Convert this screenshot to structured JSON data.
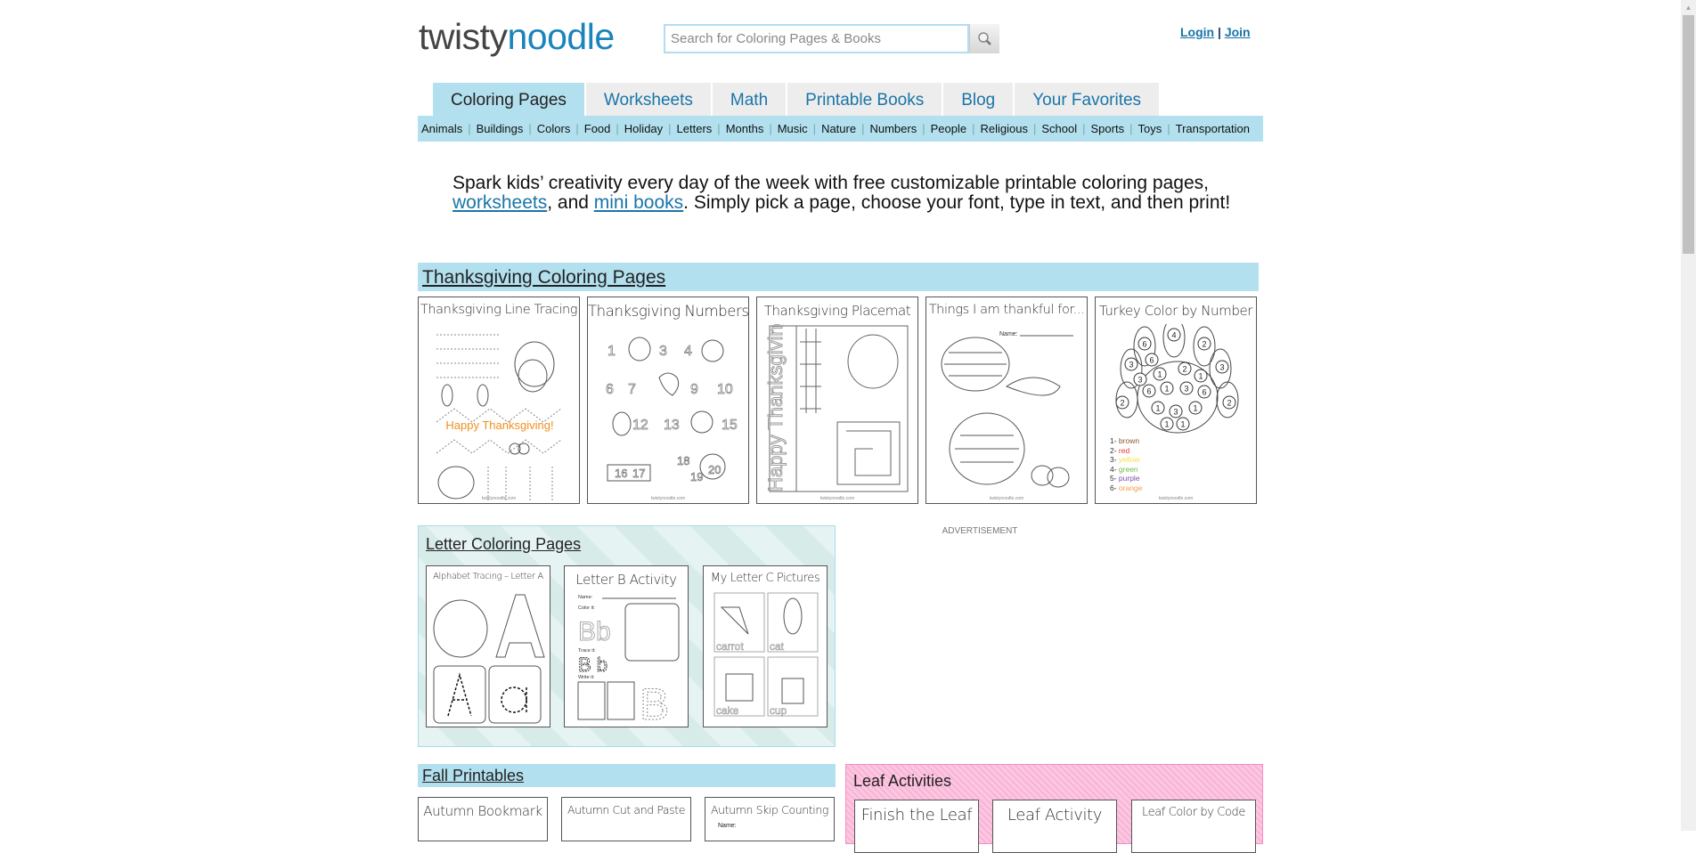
{
  "header": {
    "logo_part1": "twisty",
    "logo_part2": "noodle",
    "search_placeholder": "Search for Coloring Pages & Books",
    "search_icon": "magnifier-icon",
    "login": "Login",
    "separator": "|",
    "join": "Join"
  },
  "tabs": [
    {
      "label": "Coloring Pages",
      "active": true
    },
    {
      "label": "Worksheets"
    },
    {
      "label": "Math"
    },
    {
      "label": "Printable Books"
    },
    {
      "label": "Blog"
    },
    {
      "label": "Your Favorites"
    }
  ],
  "subnav": [
    "Animals",
    "Buildings",
    "Colors",
    "Food",
    "Holiday",
    "Letters",
    "Months",
    "Music",
    "Nature",
    "Numbers",
    "People",
    "Religious",
    "School",
    "Sports",
    "Toys",
    "Transportation"
  ],
  "intro": {
    "text1": "Spark kids’ creativity every day of the week with free customizable printable coloring pages, ",
    "link1": "worksheets",
    "text2": ", and ",
    "link2": "mini books",
    "text3": ". Simply pick a page, choose your font, type in text, and then print!"
  },
  "thanksgiving": {
    "title": "Thanksgiving Coloring Pages",
    "cards": [
      {
        "title": "Thanksgiving Line Tracing",
        "caption": "Happy Thanksgiving!"
      },
      {
        "title": "Thanksgiving Numbers",
        "numbers": [
          "1",
          "3",
          "4",
          "6",
          "7",
          "9",
          "10",
          "12",
          "13",
          "15",
          "16",
          "17",
          "18",
          "19",
          "20"
        ]
      },
      {
        "title": "Thanksgiving Placemat",
        "side_text": "Happy Thanksgiving"
      },
      {
        "title": "Things I am thankful for...",
        "name_label": "Name:"
      },
      {
        "title": "Turkey Color by Number",
        "legend": [
          {
            "label": "1- brown",
            "color": "#8b5a2b"
          },
          {
            "label": "2- red",
            "color": "#e53935"
          },
          {
            "label": "3- yellow",
            "color": "#f5e14a"
          },
          {
            "label": "4- green",
            "color": "#6abf4b"
          },
          {
            "label": "5- purple",
            "color": "#7b4fa6"
          },
          {
            "label": "6- orange",
            "color": "#f5a04a"
          }
        ]
      }
    ],
    "footer": "twistynoodle.com"
  },
  "letters": {
    "title": "Letter Coloring Pages",
    "cards": [
      {
        "title": "Alphabet Tracing – Letter A"
      },
      {
        "title": "Letter B Activity",
        "labels": [
          "Name:",
          "Color it:",
          "Trace it:",
          "Write it:"
        ]
      },
      {
        "title": "My Letter C Pictures",
        "words": [
          "carrot",
          "cat",
          "cake",
          "cup"
        ]
      }
    ]
  },
  "advertisement": "ADVERTISEMENT",
  "fall": {
    "title": "Fall Printables",
    "cards": [
      {
        "title": "Autumn Bookmark"
      },
      {
        "title": "Autumn Cut and Paste"
      },
      {
        "title": "Autumn Skip Counting",
        "name_label": "Name:"
      }
    ]
  },
  "leaf": {
    "title": "Leaf Activities",
    "cards": [
      {
        "title": "Finish the Leaf"
      },
      {
        "title": "Leaf Activity"
      },
      {
        "title": "Leaf Color by Code"
      }
    ]
  },
  "colors": {
    "brand_blue": "#1a84bb",
    "nav_blue": "#b3e0ef",
    "tab_gray": "#ededed",
    "leaf_pink": "#f9b3d6",
    "orange": "#f0901e"
  }
}
